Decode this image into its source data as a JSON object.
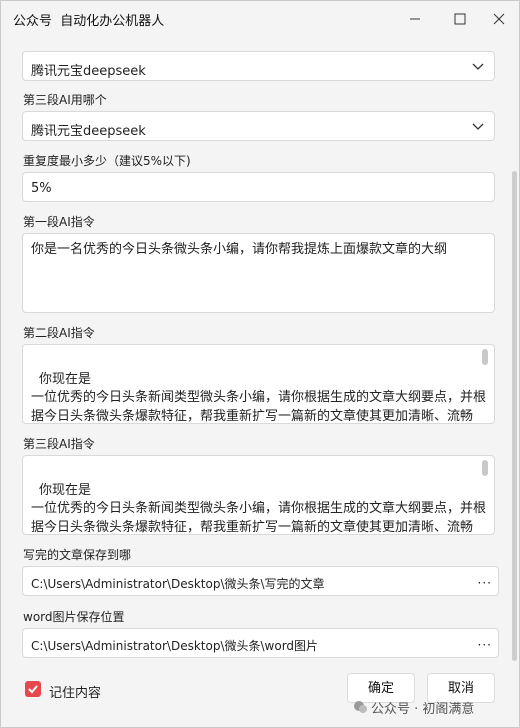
{
  "window": {
    "title": "公众号  自动化办公机器人"
  },
  "form": {
    "top_select_value": "腾讯元宝deepseek",
    "third_ai_label": "第三段AI用哪个",
    "third_ai_value": "腾讯元宝deepseek",
    "dup_label": "重复度最小多少（建议5%以下)",
    "dup_value": "5%",
    "prompt1_label": "第一段AI指令",
    "prompt1_value": "你是一名优秀的今日头条微头条小编，请你帮我提炼上面爆款文章的大纲",
    "prompt2_label": "第二段AI指令",
    "prompt2_line1": "你现在是",
    "prompt2_line2": "一位优秀的今日头条新闻类型微头条小编，请你根据生成的文章大纲要点，并根",
    "prompt2_line3": "据今日头条微头条爆款特征，帮我重新扩写一篇新的文章使其更加清晰、流畅",
    "prompt3_label": "第三段AI指令",
    "prompt3_line1": "你现在是",
    "prompt3_line2": "一位优秀的今日头条新闻类型微头条小编，请你根据生成的文章大纲要点，并根",
    "prompt3_line3": "据今日头条微头条爆款特征，帮我重新扩写一篇新的文章使其更加清晰、流畅",
    "save_label": "写完的文章保存到哪",
    "save_path": "C:\\Users\\Administrator\\Desktop\\微头条\\写完的文章",
    "img_label": "word图片保存位置",
    "img_path": "C:\\Users\\Administrator\\Desktop\\微头条\\word图片",
    "browse_dots": "···"
  },
  "footer": {
    "remember_label": "记住内容",
    "remember_checked": true,
    "ok_label": "确定",
    "cancel_label": "取消",
    "watermark": "公众号 · 初阁满意"
  },
  "colors": {
    "checkbox": "#e5484d",
    "background": "#f4f4f4"
  },
  "icons": [
    "minimize-icon",
    "maximize-icon",
    "close-icon",
    "chevron-down-icon",
    "check-icon"
  ]
}
